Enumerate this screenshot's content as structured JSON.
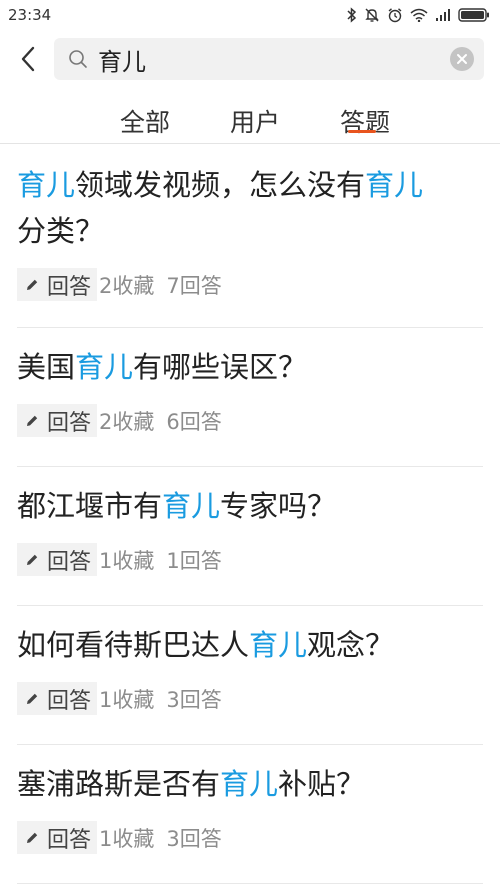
{
  "status_bar": {
    "time": "23:34",
    "icons": [
      "bluetooth-icon",
      "alarm-off-icon",
      "alarm-icon",
      "wifi-icon",
      "signal-icon",
      "battery-icon"
    ]
  },
  "search": {
    "query": "育儿",
    "icons": [
      "back-icon",
      "search-icon",
      "clear-icon"
    ]
  },
  "tabs": [
    {
      "label": "全部"
    },
    {
      "label": "用户"
    },
    {
      "label": "答题",
      "active": true
    }
  ],
  "colors": {
    "highlight": "#1a9be0",
    "tab_indicator": "#e8541e"
  },
  "results": [
    {
      "title_parts": [
        {
          "text": "育儿",
          "hl": true
        },
        {
          "text": "领域发视频，怎么没有",
          "hl": false
        },
        {
          "text": "育儿",
          "hl": true
        },
        {
          "text": "分类？",
          "hl": false
        }
      ],
      "answer_label": "回答",
      "favorites": "2收藏",
      "answers": "7回答"
    },
    {
      "title_parts": [
        {
          "text": "美国",
          "hl": false
        },
        {
          "text": "育儿",
          "hl": true
        },
        {
          "text": "有哪些误区？",
          "hl": false
        }
      ],
      "answer_label": "回答",
      "favorites": "2收藏",
      "answers": "6回答"
    },
    {
      "title_parts": [
        {
          "text": "都江堰市有",
          "hl": false
        },
        {
          "text": "育儿",
          "hl": true
        },
        {
          "text": "专家吗？",
          "hl": false
        }
      ],
      "answer_label": "回答",
      "favorites": "1收藏",
      "answers": "1回答"
    },
    {
      "title_parts": [
        {
          "text": "如何看待斯巴达人",
          "hl": false
        },
        {
          "text": "育儿",
          "hl": true
        },
        {
          "text": "观念？",
          "hl": false
        }
      ],
      "answer_label": "回答",
      "favorites": "1收藏",
      "answers": "3回答"
    },
    {
      "title_parts": [
        {
          "text": "塞浦路斯是否有",
          "hl": false
        },
        {
          "text": "育儿",
          "hl": true
        },
        {
          "text": "补贴？",
          "hl": false
        }
      ],
      "answer_label": "回答",
      "favorites": "1收藏",
      "answers": "3回答"
    }
  ]
}
